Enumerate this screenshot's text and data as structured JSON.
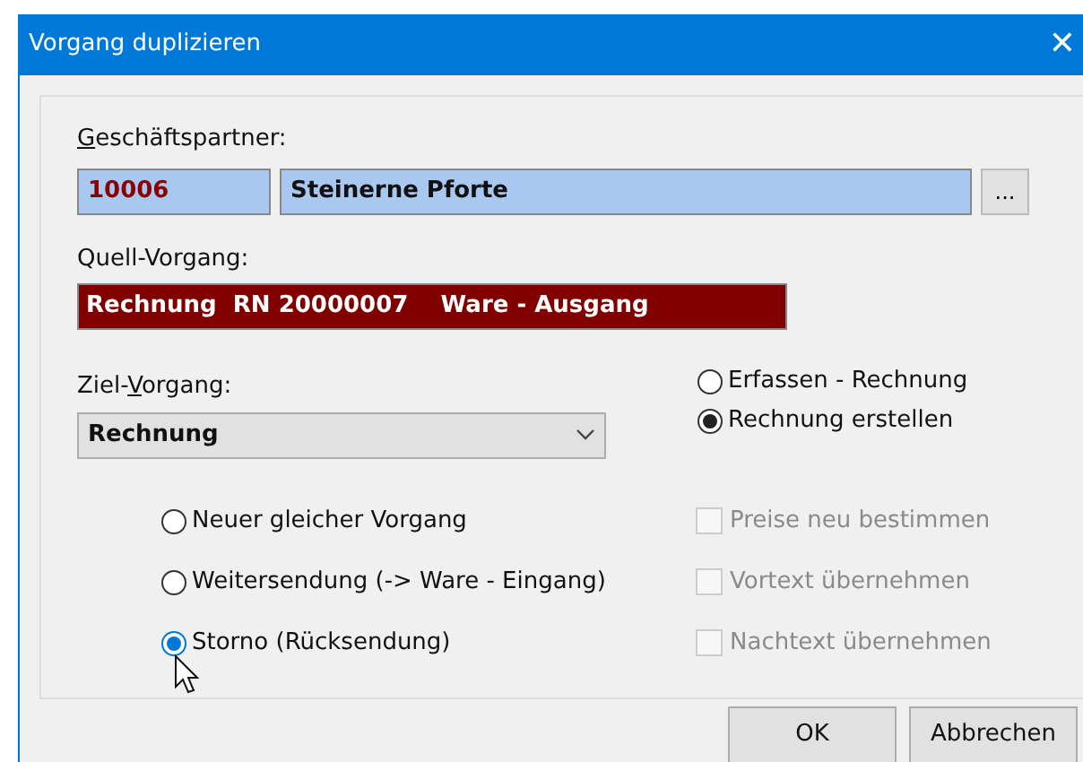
{
  "window": {
    "title": "Vorgang duplizieren",
    "close": "✕"
  },
  "partner": {
    "label": [
      {
        "text": "G",
        "underline": true
      },
      {
        "text": "eschäftspartner:",
        "underline": false
      }
    ],
    "number": "10006",
    "name": "Steinerne Pforte",
    "browse": "..."
  },
  "source": {
    "label": "Quell-Vorgang:",
    "value": "Rechnung  RN 20000007    Ware - Ausgang"
  },
  "target": {
    "label": [
      {
        "text": "Ziel-",
        "underline": false
      },
      {
        "text": "V",
        "underline": true
      },
      {
        "text": "organg:",
        "underline": false
      }
    ],
    "value": "Rechnung"
  },
  "mode_options": [
    {
      "label": "Erfassen - Rechnung",
      "selected": false
    },
    {
      "label": "Rechnung erstellen",
      "selected": true
    }
  ],
  "duplicate_options": [
    {
      "label": "Neuer gleicher Vorgang",
      "selected": false
    },
    {
      "label": "Weitersendung (-> Ware - Eingang)",
      "selected": false
    },
    {
      "label": "Storno (Rücksendung)",
      "selected": true
    }
  ],
  "checkboxes": [
    {
      "label": "Preise neu bestimmen",
      "checked": false,
      "disabled": true
    },
    {
      "label": "Vortext übernehmen",
      "checked": false,
      "disabled": true
    },
    {
      "label": "Nachtext übernehmen",
      "checked": false,
      "disabled": true
    }
  ],
  "buttons": [
    "OK",
    "Abbrechen"
  ]
}
